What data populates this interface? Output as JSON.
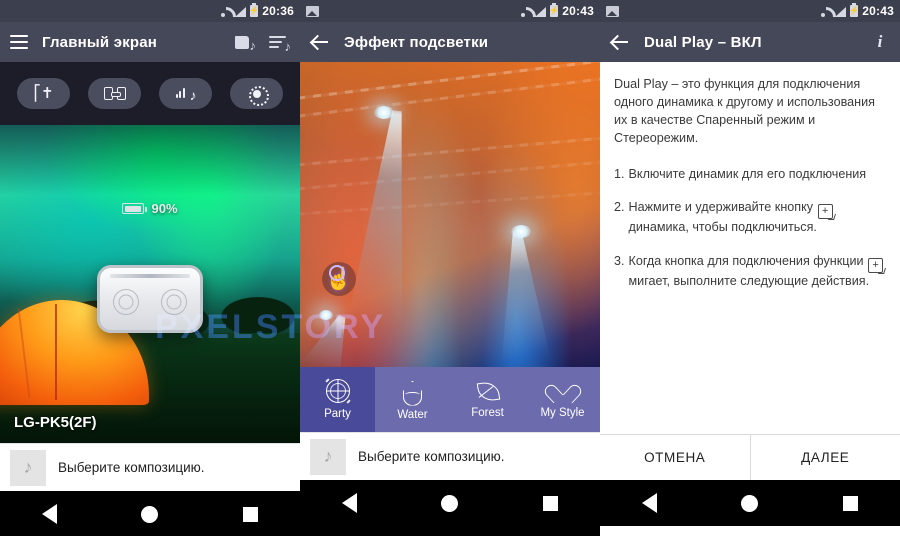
{
  "panels": [
    {
      "status": {
        "time": "20:36",
        "icons": [
          "wifi-icon",
          "signal-icon",
          "battery-charging-icon"
        ]
      },
      "appbar": {
        "menu_icon": "hamburger-icon",
        "title": "Главный экран",
        "actions": [
          "folder-music-icon",
          "playlist-music-icon"
        ]
      },
      "quick_actions": [
        {
          "name": "bluetooth",
          "icon": "bluetooth-icon"
        },
        {
          "name": "dual-play",
          "icon": "dual-play-icon"
        },
        {
          "name": "sound-effect",
          "icon": "equalizer-music-icon"
        },
        {
          "name": "lighting",
          "icon": "brightness-icon"
        }
      ],
      "artwork": {
        "battery_label": "90%",
        "device_label": "LG-PK5(2F)",
        "watermark": "PXELSTORY"
      },
      "now_playing": {
        "text": "Выберите композицию.",
        "thumb_icon": "music-note-icon"
      }
    },
    {
      "status": {
        "time": "20:43",
        "left_icon": "image-icon",
        "icons": [
          "wifi-icon",
          "signal-icon",
          "battery-charging-icon"
        ]
      },
      "appbar": {
        "back_icon": "back-arrow-icon",
        "title": "Эффект подсветки"
      },
      "effect_tabs": [
        {
          "label": "Party",
          "icon": "disco-ball-icon",
          "active": true
        },
        {
          "label": "Water",
          "icon": "water-drop-icon",
          "active": false
        },
        {
          "label": "Forest",
          "icon": "leaf-icon",
          "active": false
        },
        {
          "label": "My Style",
          "icon": "heart-icon",
          "active": false
        }
      ],
      "cursor": {
        "icon": "tap-hand-icon"
      },
      "now_playing": {
        "text": "Выберите композицию.",
        "thumb_icon": "music-note-icon"
      }
    },
    {
      "status": {
        "time": "20:43",
        "left_icon": "image-icon",
        "icons": [
          "wifi-icon",
          "signal-icon",
          "battery-charging-icon"
        ]
      },
      "appbar": {
        "back_icon": "back-arrow-icon",
        "title": "Dual Play – ВКЛ",
        "info_icon": "info-icon"
      },
      "content": {
        "intro": "Dual Play – это функция для подключения одного динамика к другому и использования их в качестве Спаренный режим и Стереорежим.",
        "steps": [
          {
            "num": "1.",
            "text_before": "Включите динамик для его подключения",
            "glyph": "",
            "text_after": ""
          },
          {
            "num": "2.",
            "text_before": "Нажмите и удерживайте кнопку",
            "glyph": "+",
            "text_after": "динамика, чтобы подключиться."
          },
          {
            "num": "3.",
            "text_before": "Когда кнопка для подключения функции",
            "glyph": "+",
            "text_after": "мигает, выполните следующие действия."
          }
        ]
      },
      "actions": [
        {
          "label": "ОТМЕНА",
          "name": "cancel"
        },
        {
          "label": "ДАЛЕЕ",
          "name": "next"
        }
      ]
    }
  ],
  "navbar": {
    "back": "back-triangle-icon",
    "home": "home-circle-icon",
    "recents": "recents-square-icon"
  },
  "colors": {
    "statusbar": "#3c3f4e",
    "appbar": "#454859",
    "quickrow": "#1c1d28",
    "tabbar": "#6c6bad",
    "tab_active": "#4a4a9b"
  }
}
